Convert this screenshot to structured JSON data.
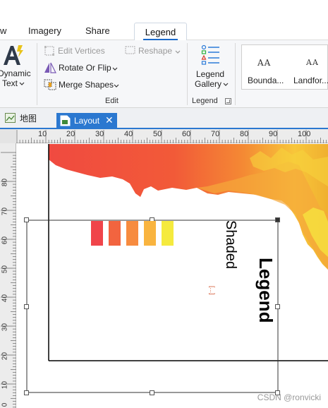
{
  "ribbon_tabs": {
    "items": [
      {
        "label": "w"
      },
      {
        "label": "Imagery"
      },
      {
        "label": "Share"
      }
    ],
    "active": "Legend"
  },
  "ribbon": {
    "dynamic_text": {
      "line1": "Dynamic",
      "line2": "Text"
    },
    "edit_group": {
      "edit_vertices": "Edit Vertices",
      "reshape": "Reshape",
      "rotate_or_flip": "Rotate Or Flip",
      "merge_shapes": "Merge Shapes",
      "label": "Edit"
    },
    "legend_group": {
      "gallery_line1": "Legend",
      "gallery_line2": "Gallery",
      "label": "Legend"
    },
    "style_gallery": [
      {
        "sample": "AA",
        "label": "Bounda..."
      },
      {
        "sample": "AA",
        "label": "Landfor..."
      }
    ]
  },
  "doc_tabs": {
    "map": "地图",
    "layout": "Layout"
  },
  "ruler": {
    "top": [
      "10",
      "20",
      "30",
      "40",
      "50",
      "60",
      "70",
      "80",
      "90",
      "100"
    ],
    "left": [
      "80",
      "70",
      "60",
      "50",
      "40",
      "30",
      "20",
      "10",
      "0"
    ]
  },
  "layout": {
    "legend_title": "Legend",
    "shaded_label": "Shaded",
    "overflow_marker": "[...]",
    "swatch_colors": [
      "#f0444a",
      "#f2643f",
      "#f78b3f",
      "#f9b43f",
      "#f5ea3e"
    ]
  },
  "watermark": "CSDN @ronvicki"
}
